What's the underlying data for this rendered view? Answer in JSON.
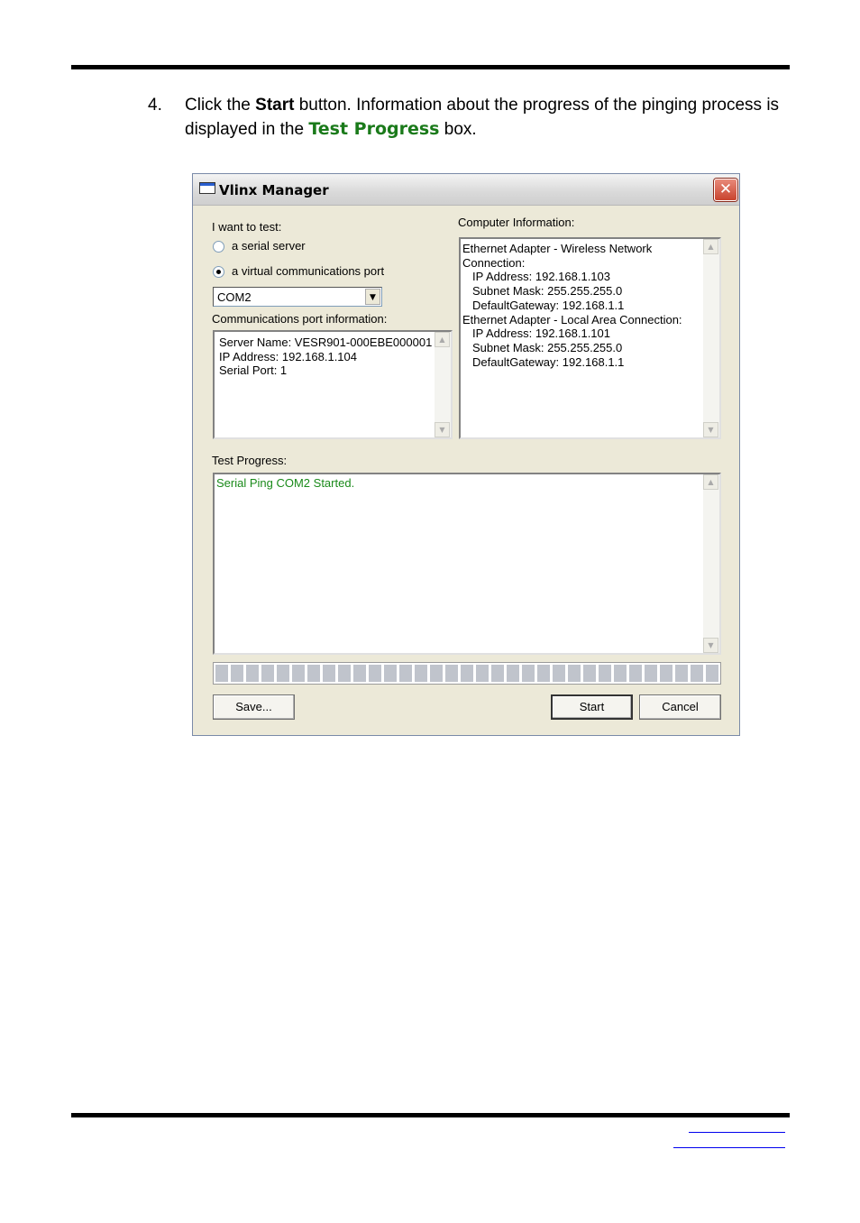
{
  "step": {
    "number": "4.",
    "text_before": "Click the ",
    "start_word": "Start",
    "text_middle": " button. Information about the progress of the pinging process is displayed in the ",
    "test_progress_word": "Test Progress",
    "text_after": " box."
  },
  "dialog": {
    "title": "Vlinx Manager",
    "close_glyph": "✕",
    "i_want_to_test": "I want to test:",
    "options": [
      {
        "label": "a serial server",
        "selected": false
      },
      {
        "label": "a virtual communications port",
        "selected": true
      }
    ],
    "port_select": {
      "value": "COM2"
    },
    "comm_port_info_label": "Communications port information:",
    "comm_port_info": [
      "Server Name: VESR901-000EBE000001",
      "IP Address: 192.168.1.104",
      "Serial Port: 1"
    ],
    "computer_info_label": "Computer Information:",
    "computer_info": [
      {
        "text": "Ethernet Adapter - Wireless Network",
        "indent": false
      },
      {
        "text": "Connection:",
        "indent": false
      },
      {
        "text": "IP Address: 192.168.1.103",
        "indent": true
      },
      {
        "text": "Subnet Mask: 255.255.255.0",
        "indent": true
      },
      {
        "text": "DefaultGateway: 192.168.1.1",
        "indent": true
      },
      {
        "text": "Ethernet Adapter - Local Area Connection:",
        "indent": false
      },
      {
        "text": "IP Address: 192.168.1.101",
        "indent": true
      },
      {
        "text": "Subnet Mask: 255.255.255.0",
        "indent": true
      },
      {
        "text": "DefaultGateway: 192.168.1.1",
        "indent": true
      }
    ],
    "test_progress_label": "Test Progress:",
    "test_progress_lines": [
      "Serial Ping COM2 Started."
    ],
    "progress_fraction": 0,
    "buttons": {
      "save": "Save...",
      "start": "Start",
      "cancel": "Cancel"
    },
    "colors": {
      "progress_text": "#1a8a1a"
    }
  }
}
